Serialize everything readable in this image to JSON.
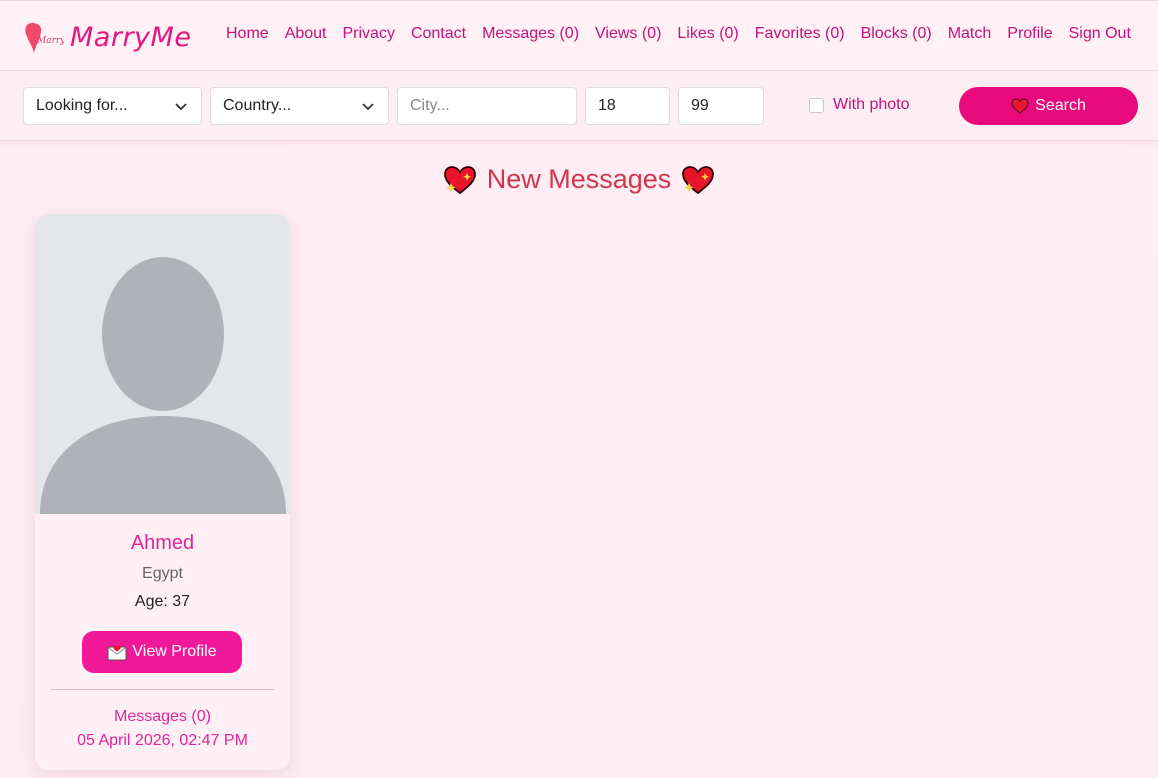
{
  "brand": {
    "name": "MarryMe",
    "accent": "#e4197f"
  },
  "nav": {
    "items": [
      {
        "label": "Home"
      },
      {
        "label": "About"
      },
      {
        "label": "Privacy"
      },
      {
        "label": "Contact"
      },
      {
        "label": "Messages (0)"
      },
      {
        "label": "Views (0)"
      },
      {
        "label": "Likes (0)"
      },
      {
        "label": "Favorites (0)"
      },
      {
        "label": "Blocks (0)"
      },
      {
        "label": "Match"
      },
      {
        "label": "Profile"
      },
      {
        "label": "Sign Out"
      }
    ]
  },
  "filters": {
    "looking_for": "Looking for...",
    "country": "Country...",
    "city_placeholder": "City...",
    "age_min": "18",
    "age_max": "99",
    "with_photo_label": "With photo",
    "search_label": "Search",
    "search_color": "#e8097c"
  },
  "page": {
    "title": "New Messages"
  },
  "cards": [
    {
      "name": "Ahmed",
      "country": "Egypt",
      "age_text": "Age: 37",
      "view_label": "View Profile",
      "messages_text": "Messages (0)",
      "date_text": "05 April 2026, 02:47 PM"
    }
  ]
}
